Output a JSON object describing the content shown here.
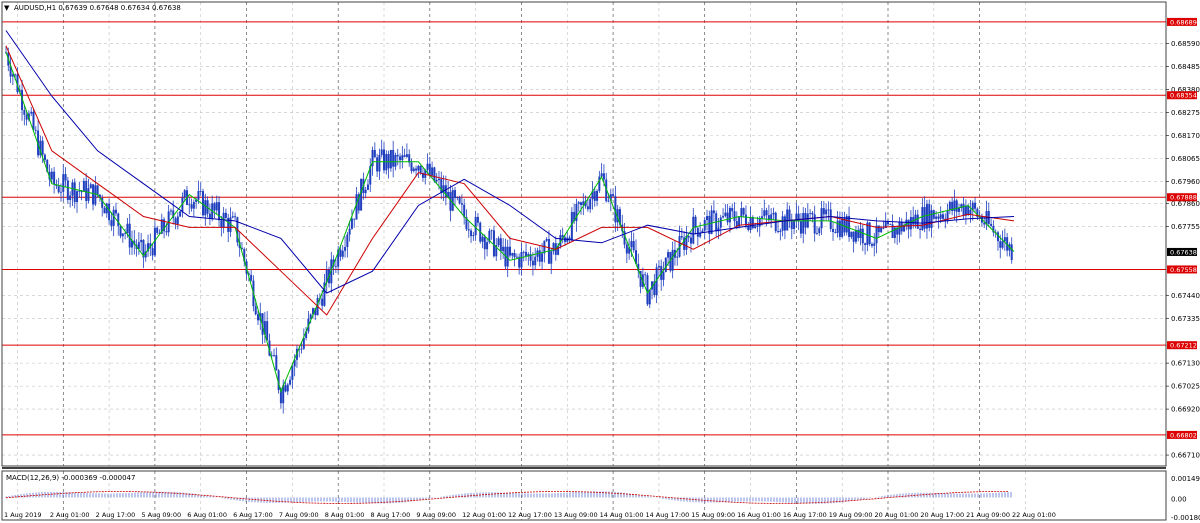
{
  "header": {
    "symbol_info": "AUDUSD,H1  0.67639 0.67648 0.67634 0.67638",
    "macd_info": "MACD(12,26,9) -0.000369 -0.000047"
  },
  "price_axis": {
    "ticks": [
      "0.68590",
      "0.68485",
      "0.68380",
      "0.68275",
      "0.68170",
      "0.68065",
      "0.67960",
      "0.67860",
      "0.67755",
      "0.67440",
      "0.67335",
      "0.67130",
      "0.67025",
      "0.66920",
      "0.66710"
    ]
  },
  "macd_axis": {
    "ticks": [
      "0.001491",
      "0.00",
      "-0.001808"
    ]
  },
  "time_axis": {
    "labels": [
      "1 Aug 2019",
      "2 Aug 01:00",
      "2 Aug 17:00",
      "5 Aug 09:00",
      "6 Aug 01:00",
      "6 Aug 17:00",
      "7 Aug 09:00",
      "8 Aug 01:00",
      "8 Aug 17:00",
      "9 Aug 09:00",
      "12 Aug 01:00",
      "12 Aug 17:00",
      "13 Aug 09:00",
      "14 Aug 01:00",
      "14 Aug 17:00",
      "15 Aug 09:00",
      "16 Aug 01:00",
      "16 Aug 17:00",
      "19 Aug 09:00",
      "20 Aug 01:00",
      "20 Aug 17:00",
      "21 Aug 09:00",
      "22 Aug 01:00"
    ]
  },
  "level_lines": [
    {
      "label": "0.68689",
      "value": 0.68689
    },
    {
      "label": "0.68354",
      "value": 0.68354
    },
    {
      "label": "0.67888",
      "value": 0.67888
    },
    {
      "label": "0.67558",
      "value": 0.67558
    },
    {
      "label": "0.67212",
      "value": 0.67212
    },
    {
      "label": "0.66802",
      "value": 0.66802
    }
  ],
  "current_price": {
    "label": "0.67638",
    "value": 0.67638
  },
  "colors": {
    "candle": "#1f3fbf",
    "level_line": "#dd0000",
    "ma_fast": "#00bb00",
    "ma_mid": "#cc0000",
    "ma_slow": "#0000aa",
    "macd_signal": "#cc0000",
    "grid": "#c0c0c0",
    "separator": "#404040"
  },
  "chart_data": {
    "type": "line",
    "title": "AUDUSD,H1",
    "ylim": [
      0.6666,
      0.6878
    ],
    "x": [
      "1 Aug 2019",
      "2 Aug 01:00",
      "2 Aug 17:00",
      "5 Aug 09:00",
      "6 Aug 01:00",
      "6 Aug 17:00",
      "7 Aug 09:00",
      "8 Aug 01:00",
      "8 Aug 17:00",
      "9 Aug 09:00",
      "12 Aug 01:00",
      "12 Aug 17:00",
      "13 Aug 09:00",
      "14 Aug 01:00",
      "14 Aug 17:00",
      "15 Aug 09:00",
      "16 Aug 01:00",
      "16 Aug 17:00",
      "19 Aug 09:00",
      "20 Aug 01:00",
      "20 Aug 17:00",
      "21 Aug 09:00",
      "22 Aug 01:00"
    ],
    "series": [
      {
        "values": [
          0.6855,
          0.6795,
          0.679,
          0.6762,
          0.679,
          0.6775,
          0.67,
          0.675,
          0.6805,
          0.6805,
          0.678,
          0.676,
          0.6765,
          0.6798,
          0.6745,
          0.6775,
          0.678,
          0.6778,
          0.6778,
          0.677,
          0.678,
          0.6785,
          0.6764
        ]
      },
      {
        "values": [
          0.6858,
          0.681,
          0.6795,
          0.678,
          0.6775,
          0.6775,
          0.6755,
          0.6735,
          0.677,
          0.68,
          0.6795,
          0.677,
          0.6765,
          0.6775,
          0.6775,
          0.6765,
          0.6776,
          0.6778,
          0.678,
          0.6775,
          0.6776,
          0.6781,
          0.6778
        ]
      },
      {
        "values": [
          0.6865,
          0.6835,
          0.681,
          0.6795,
          0.678,
          0.6778,
          0.677,
          0.6745,
          0.6755,
          0.6785,
          0.6797,
          0.6785,
          0.677,
          0.6768,
          0.6776,
          0.6772,
          0.6775,
          0.6778,
          0.678,
          0.6778,
          0.6777,
          0.6779,
          0.678
        ]
      }
    ]
  }
}
